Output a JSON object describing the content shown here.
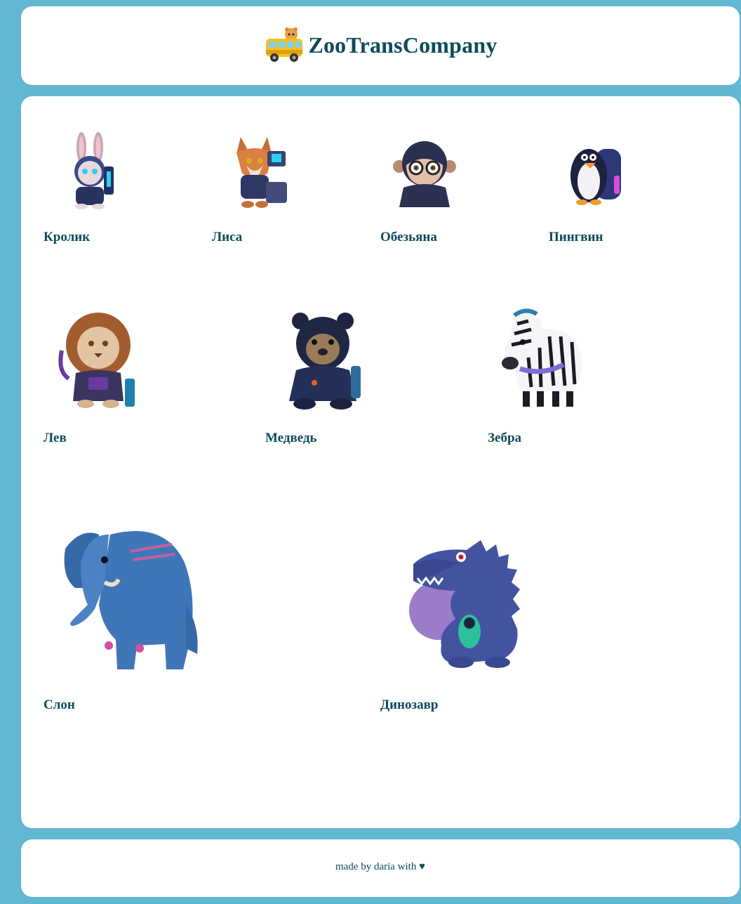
{
  "header": {
    "title": "ZooTransCompany",
    "logo_icon": "bus-with-animal-icon"
  },
  "animals": [
    {
      "name": "Кролик",
      "icon": "rabbit-robot-icon"
    },
    {
      "name": "Лиса",
      "icon": "fox-robot-icon"
    },
    {
      "name": "Обезьяна",
      "icon": "monkey-robot-icon"
    },
    {
      "name": "Пингвин",
      "icon": "penguin-robot-icon"
    },
    {
      "name": "Лев",
      "icon": "lion-robot-icon"
    },
    {
      "name": "Медведь",
      "icon": "bear-robot-icon"
    },
    {
      "name": "Зебра",
      "icon": "zebra-robot-icon"
    },
    {
      "name": "Слон",
      "icon": "elephant-robot-icon"
    },
    {
      "name": "Динозавр",
      "icon": "dinosaur-robot-icon"
    }
  ],
  "footer": {
    "text": "made by daria with ♥"
  },
  "colors": {
    "background": "#62b7d2",
    "card": "#ffffff",
    "text": "#0e4a5c"
  }
}
